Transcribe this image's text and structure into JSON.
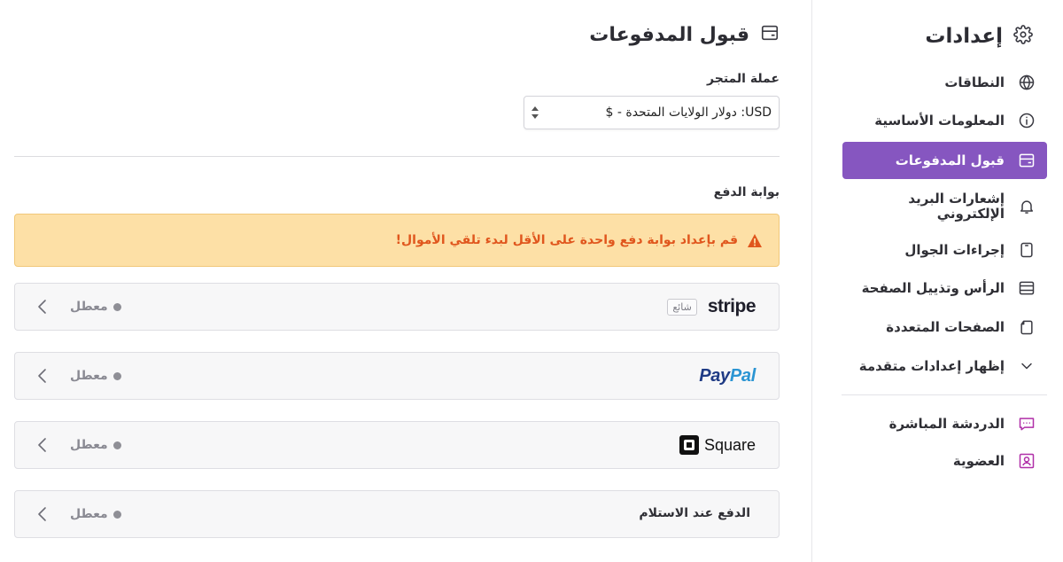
{
  "sidebar": {
    "title": "إعدادات",
    "icon": "gear-icon",
    "items": [
      {
        "label": "النطاقات",
        "icon": "globe-icon"
      },
      {
        "label": "المعلومات الأساسية",
        "icon": "info-icon"
      },
      {
        "label": "قبول المدفوعات",
        "icon": "card-icon",
        "active": true
      },
      {
        "label": "إشعارات البريد الإلكتروني",
        "icon": "bell-icon"
      },
      {
        "label": "إجراءات الجوال",
        "icon": "mobile-icon"
      },
      {
        "label": "الرأس وتذييل الصفحة",
        "icon": "layout-icon"
      },
      {
        "label": "الصفحات المتعددة",
        "icon": "pages-icon"
      },
      {
        "label": "إظهار إعدادات متقدمة",
        "icon": "chevron-down-icon"
      }
    ],
    "extra": [
      {
        "label": "الدردشة المباشرة",
        "icon": "chat-icon"
      },
      {
        "label": "العضوية",
        "icon": "member-icon"
      }
    ]
  },
  "main": {
    "title": "قبول المدفوعات",
    "title_icon": "card-icon",
    "currency": {
      "label": "عملة المتجر",
      "value": "USD: دولار الولايات المتحدة - $"
    },
    "gateway_label": "بوابة الدفع",
    "alert": "قم بإعداد بوابة دفع واحدة على الأقل لبدء تلقي الأموال!",
    "gateways": [
      {
        "name": "stripe",
        "badge": "شائع",
        "status": "معطل"
      },
      {
        "name_part1": "Pay",
        "name_part2": "Pal",
        "status": "معطل"
      },
      {
        "name": "Square",
        "status": "معطل"
      },
      {
        "name": "الدفع عند الاستلام",
        "status": "معطل"
      }
    ]
  },
  "colors": {
    "accent": "#8656c0",
    "alert_bg": "#fde0a6",
    "alert_text": "#e0561d",
    "paypal_dark": "#1f3b85",
    "paypal_light": "#2b95d3"
  }
}
